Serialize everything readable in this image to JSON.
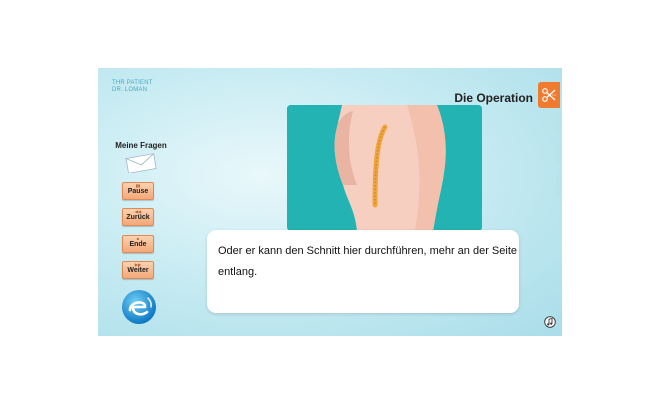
{
  "patient": {
    "line1": "THR PATIENT",
    "line2": "DR. LOMAN"
  },
  "header": {
    "title": "Die Operation",
    "icon": "scissors-icon"
  },
  "sidebar": {
    "questions_label": "Meine Fragen",
    "buttons": [
      {
        "label": "Pause"
      },
      {
        "label": "Zurück"
      },
      {
        "label": "Ende"
      },
      {
        "label": "Weiter"
      }
    ]
  },
  "caption": {
    "text": "Oder er kann den Schnitt hier durchführen, mehr an der Seite entlang."
  },
  "colors": {
    "accent": "#f07a2e",
    "background": "#c9ecf3",
    "illustration_bg": "#23b3b2",
    "button": "#f3a878"
  }
}
